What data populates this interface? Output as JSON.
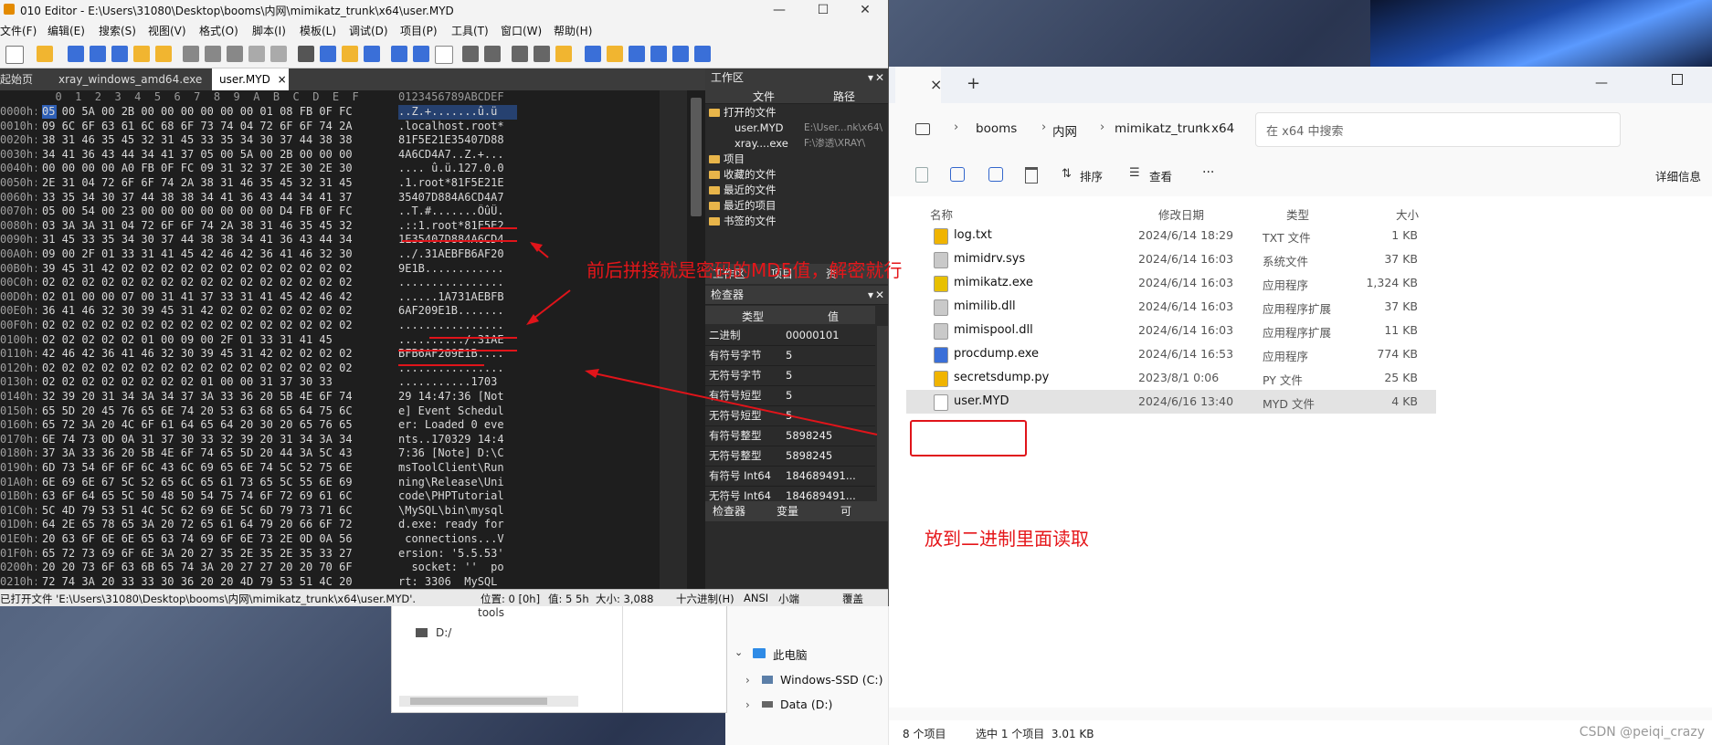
{
  "editor": {
    "title": "010 Editor - E:\\Users\\31080\\Desktop\\booms\\内网\\mimikatz_trunk\\x64\\user.MYD",
    "menu": [
      "文件(F)",
      "编辑(E)",
      "搜索(S)",
      "视图(V)",
      "格式(O)",
      "脚本(I)",
      "模板(L)",
      "调试(D)",
      "项目(P)",
      "工具(T)",
      "窗口(W)",
      "帮助(H)"
    ],
    "tabs": {
      "start": "起始页",
      "xray": "xray_windows_amd64.exe",
      "usermyd": "user.MYD",
      "close": "×"
    },
    "hex_header": {
      "offset": "",
      "cols": "  0  1  2  3  4  5  6  7  8  9  A  B  C  D  E  F",
      "ascii": "0123456789ABCDEF"
    },
    "hex_rows": [
      {
        "o": "0000h:",
        "h": "05 00 5A 00 2B 00 00 00 00 00 00 01 08 FB 0F FC",
        "a": "..Z.+.......û.ü"
      },
      {
        "o": "0010h:",
        "h": "09 6C 6F 63 61 6C 68 6F 73 74 04 72 6F 6F 74 2A",
        "a": ".localhost.root*"
      },
      {
        "o": "0020h:",
        "h": "38 31 46 35 45 32 31 45 33 35 34 30 37 44 38 38",
        "a": "81F5E21E35407D88"
      },
      {
        "o": "0030h:",
        "h": "34 41 36 43 44 34 41 37 05 00 5A 00 2B 00 00 00",
        "a": "4A6CD4A7..Z.+..."
      },
      {
        "o": "0040h:",
        "h": "00 00 00 00 A0 FB 0F FC 09 31 32 37 2E 30 2E 30",
        "a": ".... û.ü.127.0.0"
      },
      {
        "o": "0050h:",
        "h": "2E 31 04 72 6F 6F 74 2A 38 31 46 35 45 32 31 45",
        "a": ".1.root*81F5E21E"
      },
      {
        "o": "0060h:",
        "h": "33 35 34 30 37 44 38 38 34 41 36 43 44 34 41 37",
        "a": "35407D884A6CD4A7"
      },
      {
        "o": "0070h:",
        "h": "05 00 54 00 23 00 00 00 00 00 00 00 D4 FB 0F FC",
        "a": "..T.#.......ÔûÜ."
      },
      {
        "o": "0080h:",
        "h": "03 3A 3A 31 04 72 6F 6F 74 2A 38 31 46 35 45 32",
        "a": ".::1.root*81F5E2"
      },
      {
        "o": "0090h:",
        "h": "31 45 33 35 34 30 37 44 38 38 34 41 36 43 44 34",
        "a": "1E35407D884A6CD4"
      },
      {
        "o": "00A0h:",
        "h": "09 00 2F 01 33 31 41 45 42 46 42 36 41 46 32 30",
        "a": "../.31AEBFB6AF20"
      },
      {
        "o": "00B0h:",
        "h": "39 45 31 42 02 02 02 02 02 02 02 02 02 02 02 02",
        "a": "9E1B............"
      },
      {
        "o": "00C0h:",
        "h": "02 02 02 02 02 02 02 02 02 02 02 02 02 02 02 02",
        "a": "................"
      },
      {
        "o": "00D0h:",
        "h": "02 01 00 00 07 00 31 41 37 33 31 41 45 42 46 42",
        "a": "......1A731AEBFB"
      },
      {
        "o": "00E0h:",
        "h": "36 41 46 32 30 39 45 31 42 02 02 02 02 02 02 02",
        "a": "6AF209E1B......."
      },
      {
        "o": "00F0h:",
        "h": "02 02 02 02 02 02 02 02 02 02 02 02 02 02 02 02",
        "a": "................"
      },
      {
        "o": "0100h:",
        "h": "02 02 02 02 02 01 00 09 00 2F 01 33 31 41 45",
        "a": "........../.31AE"
      },
      {
        "o": "0110h:",
        "h": "42 46 42 36 41 46 32 30 39 45 31 42 02 02 02 02",
        "a": "BFB6AF209E1B...."
      },
      {
        "o": "0120h:",
        "h": "02 02 02 02 02 02 02 02 02 02 02 02 02 02 02 02",
        "a": "................"
      },
      {
        "o": "0130h:",
        "h": "02 02 02 02 02 02 02 02 01 00 00 31 37 30 33",
        "a": "...........1703"
      },
      {
        "o": "0140h:",
        "h": "32 39 20 31 34 3A 34 37 3A 33 36 20 5B 4E 6F 74",
        "a": "29 14:47:36 [Not"
      },
      {
        "o": "0150h:",
        "h": "65 5D 20 45 76 65 6E 74 20 53 63 68 65 64 75 6C",
        "a": "e] Event Schedul"
      },
      {
        "o": "0160h:",
        "h": "65 72 3A 20 4C 6F 61 64 65 64 20 30 20 65 76 65",
        "a": "er: Loaded 0 eve"
      },
      {
        "o": "0170h:",
        "h": "6E 74 73 0D 0A 31 37 30 33 32 39 20 31 34 3A 34",
        "a": "nts..170329 14:4"
      },
      {
        "o": "0180h:",
        "h": "37 3A 33 36 20 5B 4E 6F 74 65 5D 20 44 3A 5C 43",
        "a": "7:36 [Note] D:\\C"
      },
      {
        "o": "0190h:",
        "h": "6D 73 54 6F 6F 6C 43 6C 69 65 6E 74 5C 52 75 6E",
        "a": "msToolClient\\Run"
      },
      {
        "o": "01A0h:",
        "h": "6E 69 6E 67 5C 52 65 6C 65 61 73 65 5C 55 6E 69",
        "a": "ning\\Release\\Uni"
      },
      {
        "o": "01B0h:",
        "h": "63 6F 64 65 5C 50 48 50 54 75 74 6F 72 69 61 6C",
        "a": "code\\PHPTutorial"
      },
      {
        "o": "01C0h:",
        "h": "5C 4D 79 53 51 4C 5C 62 69 6E 5C 6D 79 73 71 6C",
        "a": "\\MySQL\\bin\\mysql"
      },
      {
        "o": "01D0h:",
        "h": "64 2E 65 78 65 3A 20 72 65 61 64 79 20 66 6F 72",
        "a": "d.exe: ready for"
      },
      {
        "o": "01E0h:",
        "h": "20 63 6F 6E 6E 65 63 74 69 6F 6E 73 2E 0D 0A 56",
        "a": " connections...V"
      },
      {
        "o": "01F0h:",
        "h": "65 72 73 69 6F 6E 3A 20 27 35 2E 35 2E 35 33 27",
        "a": "ersion: '5.5.53'"
      },
      {
        "o": "0200h:",
        "h": "20 20 73 6F 63 6B 65 74 3A 20 27 27 20 20 70 6F",
        "a": "  socket: ''  po"
      },
      {
        "o": "0210h:",
        "h": "72 74 3A 20 33 33 30 36 20 20 4D 79 53 51 4C 20",
        "a": "rt: 3306  MySQL "
      },
      {
        "o": "0220h:",
        "h": "43 6F 6D 6D 75 6E 69 74 79 20 53 65 72 76 65 72",
        "a": "Community Server"
      }
    ],
    "status": {
      "message": "已打开文件 'E:\\Users\\31080\\Desktop\\booms\\内网\\mimikatz_trunk\\x64\\user.MYD'.",
      "position": "位置: 0 [0h]",
      "value": "值: 5 5h",
      "size": "大小: 3,088",
      "mode": "十六进制(H)",
      "encoding": "ANSI",
      "endian": "小端",
      "insert": "覆盖"
    },
    "workspace": {
      "title": "工作区",
      "col_file": "文件",
      "col_path": "路径",
      "open_files": "打开的文件",
      "files": [
        {
          "name": "user.MYD",
          "path": "E:\\User...nk\\x64\\"
        },
        {
          "name": "xray....exe",
          "path": "F:\\渗透\\XRAY\\"
        }
      ],
      "folders": [
        "项目",
        "收藏的文件",
        "最近的文件",
        "最近的项目",
        "书签的文件"
      ],
      "bottom_tabs": [
        "工作区",
        "项目",
        "资"
      ]
    },
    "inspector": {
      "title": "检查器",
      "col_type": "类型",
      "col_value": "值",
      "rows": [
        {
          "t": "二进制",
          "v": "00000101"
        },
        {
          "t": "有符号字节",
          "v": "5"
        },
        {
          "t": "无符号字节",
          "v": "5"
        },
        {
          "t": "有符号短型",
          "v": "5"
        },
        {
          "t": "无符号短型",
          "v": "5"
        },
        {
          "t": "有符号整型",
          "v": "5898245"
        },
        {
          "t": "无符号整型",
          "v": "5898245"
        },
        {
          "t": "有符号 Int64",
          "v": "184689491..."
        },
        {
          "t": "无符号 Int64",
          "v": "184689491..."
        }
      ],
      "bottom_tabs": [
        "检查器",
        "变量",
        "可"
      ]
    }
  },
  "explorer": {
    "new_tab": "+",
    "close_tab": "×",
    "breadcrumb": [
      "booms",
      "内网",
      "mimikatz_trunk",
      "x64"
    ],
    "search_placeholder": "在 x64 中搜索",
    "commands": {
      "sort": "排序",
      "view": "查看",
      "more": "···",
      "details": "详细信息"
    },
    "columns": {
      "name": "名称",
      "date": "修改日期",
      "type": "类型",
      "size": "大小"
    },
    "files": [
      {
        "name": "log.txt",
        "date": "2024/6/14 18:29",
        "type": "TXT 文件",
        "size": "1 KB",
        "color": "#f0b400"
      },
      {
        "name": "mimidrv.sys",
        "date": "2024/6/14 16:03",
        "type": "系统文件",
        "size": "37 KB",
        "color": "#c9c9c9"
      },
      {
        "name": "mimikatz.exe",
        "date": "2024/6/14 16:03",
        "type": "应用程序",
        "size": "1,324 KB",
        "color": "#e8c000"
      },
      {
        "name": "mimilib.dll",
        "date": "2024/6/14 16:03",
        "type": "应用程序扩展",
        "size": "37 KB",
        "color": "#c9c9c9"
      },
      {
        "name": "mimispool.dll",
        "date": "2024/6/14 16:03",
        "type": "应用程序扩展",
        "size": "11 KB",
        "color": "#c9c9c9"
      },
      {
        "name": "procdump.exe",
        "date": "2024/6/14 16:53",
        "type": "应用程序",
        "size": "774 KB",
        "color": "#3a6fd8"
      },
      {
        "name": "secretsdump.py",
        "date": "2023/8/1 0:06",
        "type": "PY 文件",
        "size": "25 KB",
        "color": "#f0b400"
      },
      {
        "name": "user.MYD",
        "date": "2024/6/16 13:40",
        "type": "MYD 文件",
        "size": "4 KB",
        "color": "#ffffff"
      }
    ],
    "status": {
      "count": "8 个项目",
      "selected": "选中 1 个项目  3.01 KB"
    },
    "nav": {
      "this_pc": "此电脑",
      "c": "Windows-SSD (C:)",
      "d": "Data (D:)"
    }
  },
  "tree": {
    "tools": "tools",
    "drive": "D:/"
  },
  "annotations": {
    "md5_note": "前后拼接就是密码的MD5值，解密就行",
    "binary_note": "放到二进制里面读取"
  },
  "watermark": "CSDN @peiqi_crazy"
}
